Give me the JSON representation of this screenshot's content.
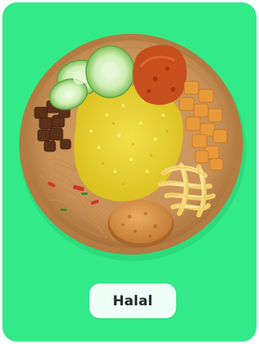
{
  "card": {
    "badge_label": "Halal",
    "image_subject": "nasi-kuning-plate",
    "colors": {
      "background": "#33ea88",
      "badge_background": "#eefdf5",
      "badge_text": "#1c2a23"
    }
  }
}
